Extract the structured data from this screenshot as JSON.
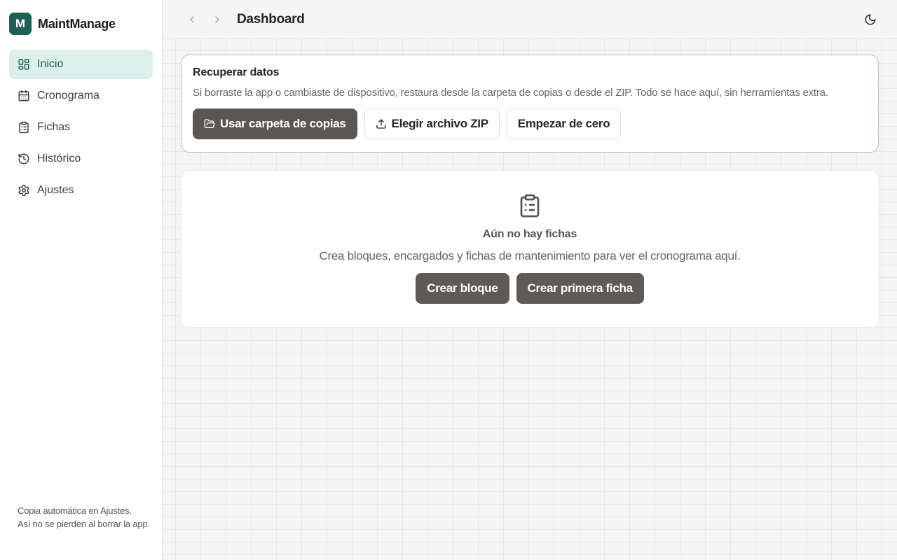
{
  "brand": {
    "logo_letter": "M",
    "name": "MaintManage"
  },
  "sidebar": {
    "items": [
      {
        "label": "Inicio",
        "icon": "dashboard-icon",
        "active": true
      },
      {
        "label": "Cronograma",
        "icon": "calendar-icon"
      },
      {
        "label": "Fichas",
        "icon": "clipboard-icon"
      },
      {
        "label": "Histórico",
        "icon": "history-icon"
      },
      {
        "label": "Ajustes",
        "icon": "gear-icon"
      }
    ],
    "footer_line1": "Copia automática en Ajustes.",
    "footer_line2": "Así no se pierden al borrar la app."
  },
  "header": {
    "title": "Dashboard",
    "back_icon": "chevron-left-icon",
    "forward_icon": "chevron-right-icon",
    "theme_icon": "moon-icon"
  },
  "recover": {
    "title": "Recuperar datos",
    "description": "Si borraste la app o cambiaste de dispositivo, restaura desde la carpeta de copias o desde el ZIP. Todo se hace aquí, sin herramientas extra.",
    "use_folder_label": "Usar carpeta de copias",
    "choose_zip_label": "Elegir archivo ZIP",
    "start_fresh_label": "Empezar de cero"
  },
  "empty_state": {
    "title": "Aún no hay fichas",
    "description": "Crea bloques, encargados y fichas de mantenimiento para ver el cronograma aquí.",
    "create_block_label": "Crear bloque",
    "create_first_label": "Crear primera ficha"
  },
  "colors": {
    "brand": "#1f5f56",
    "active_bg": "#dcefeb",
    "dark_button": "#5a5753"
  }
}
